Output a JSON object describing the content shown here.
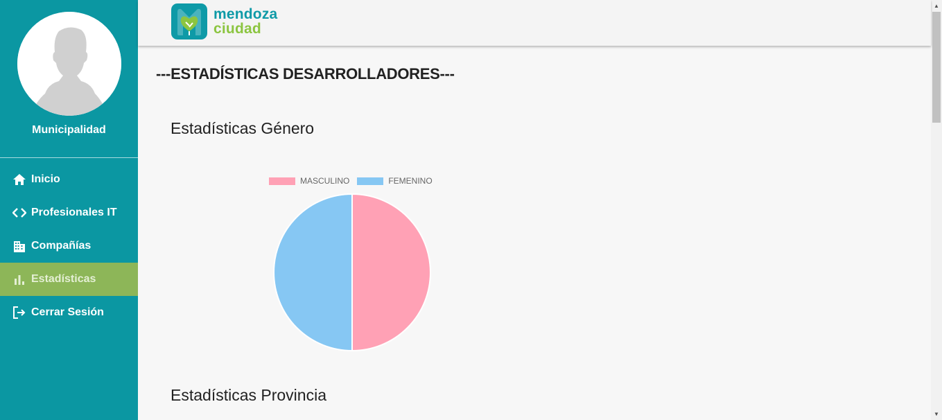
{
  "sidebar": {
    "org_name": "Municipalidad",
    "nav_items": [
      {
        "label": "Inicio",
        "icon": "home-icon"
      },
      {
        "label": "Profesionales IT",
        "icon": "code-icon"
      },
      {
        "label": "Compañías",
        "icon": "building-icon"
      },
      {
        "label": "Estadísticas",
        "icon": "bar-chart-icon",
        "active": true
      },
      {
        "label": "Cerrar Sesión",
        "icon": "logout-icon"
      }
    ]
  },
  "header": {
    "logo_line1": "mendoza",
    "logo_line2": "ciudad"
  },
  "main": {
    "page_title": "---ESTADÍSTICAS DESARROLLADORES---",
    "gender_section_title": "Estadísticas Género",
    "province_section_title": "Estadísticas Provincia"
  },
  "colors": {
    "sidebar": "#0b97a2",
    "active_nav": "#8db658",
    "masculino": "#ffa1b5",
    "femenino": "#86c7f3"
  },
  "chart_data": {
    "type": "pie",
    "title": "",
    "legend_position": "top",
    "categories": [
      "MASCULINO",
      "FEMENINO"
    ],
    "values": [
      50,
      50
    ],
    "colors": [
      "#ffa1b5",
      "#86c7f3"
    ]
  }
}
